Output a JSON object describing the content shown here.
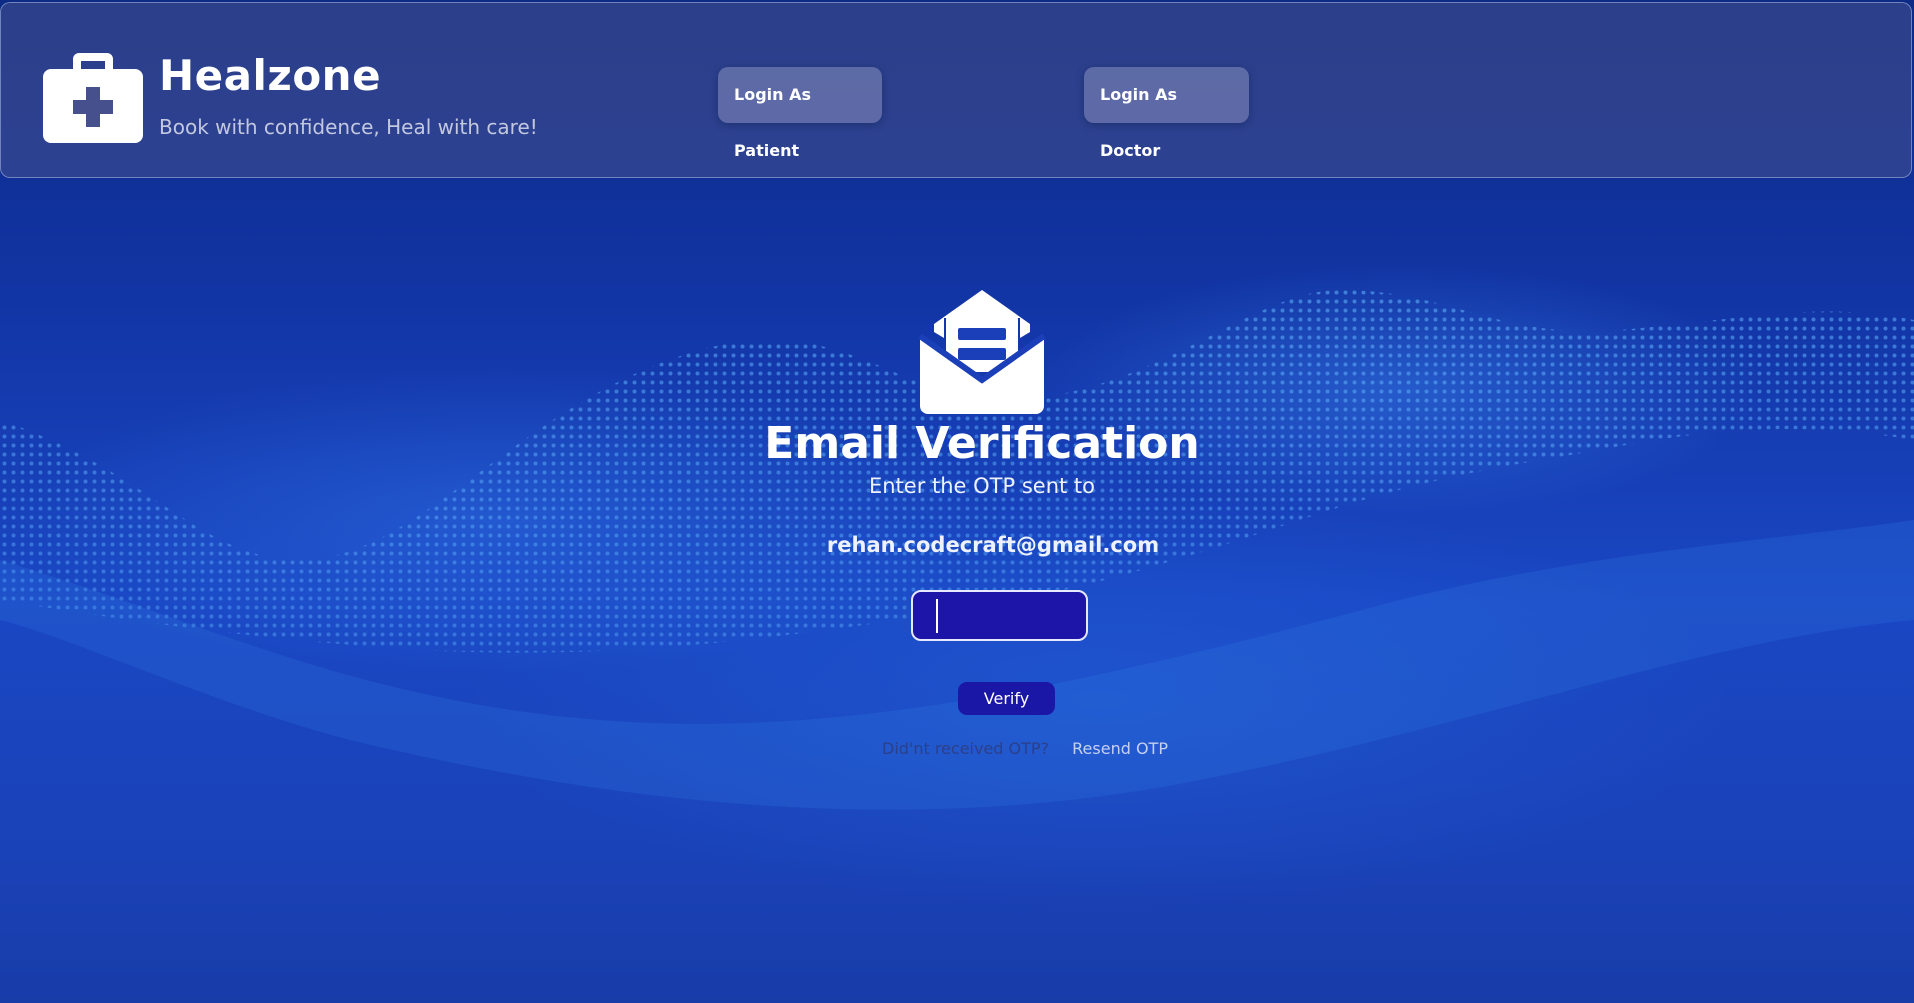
{
  "header": {
    "brand_title": "Healzone",
    "brand_tagline": "Book with confidence, Heal with care!",
    "brand_icon": "medical-kit-icon",
    "login_patient_label": "Login As Patient",
    "login_doctor_label": "Login As Doctor"
  },
  "verification": {
    "icon": "envelope-open-icon",
    "title": "Email Verification",
    "subtitle": "Enter the OTP sent to",
    "email": "rehan.codecraft@gmail.com",
    "otp_value": "",
    "otp_placeholder": "",
    "verify_label": "Verify",
    "resend_question": "Did'nt received OTP?",
    "resend_link": "Resend OTP"
  },
  "colors": {
    "background": "#1536a6",
    "header_bg": "#46508c",
    "button_primary": "#1b17a6",
    "text": "#ffffff"
  }
}
